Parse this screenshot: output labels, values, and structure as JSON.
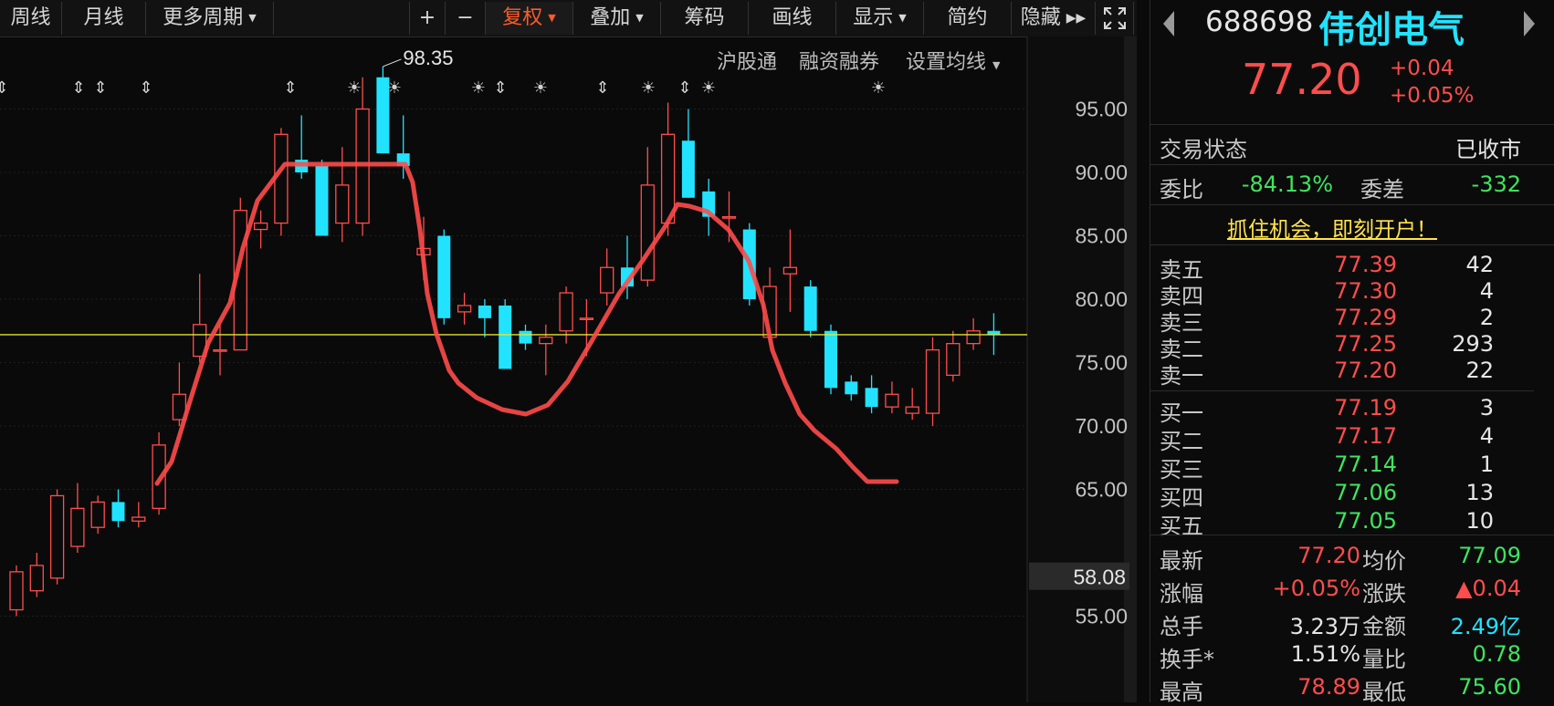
{
  "toolbar": {
    "week": "周线",
    "month": "月线",
    "more_periods": "更多周期",
    "plus": "+",
    "minus": "−",
    "fuquan": "复权",
    "overlay": "叠加",
    "chips": "筹码",
    "draw": "画线",
    "display": "显示",
    "simple": "简约",
    "hide": "隐藏",
    "fullscreen_icon": "expand-icon"
  },
  "subtoolbar": {
    "hgt": "沪股通",
    "margin": "融资融券",
    "ma_settings": "设置均线"
  },
  "chart_data": {
    "type": "candlestick",
    "y_ticks": [
      "95.00",
      "90.00",
      "85.00",
      "80.00",
      "75.00",
      "70.00",
      "65.00",
      "55.00"
    ],
    "ylim": [
      54,
      100
    ],
    "price_line": 77.2,
    "cursor_price": "58.08",
    "high_label": "98.35",
    "annotations_row": [
      "⇕",
      "⇕",
      "⇕",
      "⇕",
      "⇕",
      "☀",
      "☀",
      "☀",
      "⇕",
      "☀",
      "⇕",
      "☀",
      "⇕",
      "☀",
      "☀"
    ],
    "candles": [
      {
        "o": 55.5,
        "c": 58.5,
        "h": 59.0,
        "l": 55.0
      },
      {
        "o": 57.0,
        "c": 59.0,
        "h": 60.0,
        "l": 56.5
      },
      {
        "o": 58.0,
        "c": 64.5,
        "h": 65.0,
        "l": 57.5
      },
      {
        "o": 60.5,
        "c": 63.5,
        "h": 65.5,
        "l": 60.0
      },
      {
        "o": 62.0,
        "c": 64.0,
        "h": 64.5,
        "l": 61.5
      },
      {
        "o": 64.0,
        "c": 62.5,
        "h": 65.0,
        "l": 62.0
      },
      {
        "o": 62.5,
        "c": 62.8,
        "h": 64.0,
        "l": 62.0
      },
      {
        "o": 63.5,
        "c": 68.5,
        "h": 69.5,
        "l": 63.0
      },
      {
        "o": 70.5,
        "c": 72.5,
        "h": 75.0,
        "l": 70.0
      },
      {
        "o": 75.5,
        "c": 78.0,
        "h": 82.0,
        "l": 75.0
      },
      {
        "o": 76.0,
        "c": 76.0,
        "h": 78.0,
        "l": 74.0
      },
      {
        "o": 76.0,
        "c": 87.0,
        "h": 88.0,
        "l": 76.0
      },
      {
        "o": 85.5,
        "c": 86.0,
        "h": 87.0,
        "l": 84.0
      },
      {
        "o": 86.0,
        "c": 93.0,
        "h": 93.5,
        "l": 85.0
      },
      {
        "o": 91.0,
        "c": 90.0,
        "h": 94.5,
        "l": 89.5
      },
      {
        "o": 90.5,
        "c": 85.0,
        "h": 91.0,
        "l": 85.0
      },
      {
        "o": 86.0,
        "c": 89.0,
        "h": 92.0,
        "l": 84.5
      },
      {
        "o": 86.0,
        "c": 95.0,
        "h": 97.5,
        "l": 85.0
      },
      {
        "o": 97.5,
        "c": 91.5,
        "h": 98.35,
        "l": 91.5
      },
      {
        "o": 91.5,
        "c": 90.5,
        "h": 94.5,
        "l": 89.5
      },
      {
        "o": 83.5,
        "c": 84.0,
        "h": 86.5,
        "l": 81.5
      },
      {
        "o": 85.0,
        "c": 78.5,
        "h": 85.5,
        "l": 78.0
      },
      {
        "o": 79.0,
        "c": 79.5,
        "h": 80.5,
        "l": 78.0
      },
      {
        "o": 79.5,
        "c": 78.5,
        "h": 80.0,
        "l": 77.0
      },
      {
        "o": 79.5,
        "c": 74.5,
        "h": 80.0,
        "l": 74.5
      },
      {
        "o": 77.5,
        "c": 76.5,
        "h": 78.0,
        "l": 76.0
      },
      {
        "o": 76.5,
        "c": 77.0,
        "h": 78.0,
        "l": 74.0
      },
      {
        "o": 77.5,
        "c": 80.5,
        "h": 81.0,
        "l": 76.5
      },
      {
        "o": 78.5,
        "c": 78.5,
        "h": 80.0,
        "l": 75.5
      },
      {
        "o": 80.5,
        "c": 82.5,
        "h": 84.0,
        "l": 79.5
      },
      {
        "o": 82.5,
        "c": 81.0,
        "h": 85.0,
        "l": 80.0
      },
      {
        "o": 81.5,
        "c": 89.0,
        "h": 92.0,
        "l": 81.0
      },
      {
        "o": 86.0,
        "c": 93.0,
        "h": 95.5,
        "l": 85.0
      },
      {
        "o": 92.5,
        "c": 88.0,
        "h": 95.0,
        "l": 88.0
      },
      {
        "o": 88.5,
        "c": 86.5,
        "h": 89.5,
        "l": 85.0
      },
      {
        "o": 86.5,
        "c": 86.5,
        "h": 88.5,
        "l": 84.5
      },
      {
        "o": 85.5,
        "c": 80.0,
        "h": 86.0,
        "l": 79.5
      },
      {
        "o": 77.0,
        "c": 81.0,
        "h": 82.5,
        "l": 76.5
      },
      {
        "o": 82.0,
        "c": 82.5,
        "h": 85.5,
        "l": 79.0
      },
      {
        "o": 81.0,
        "c": 77.5,
        "h": 81.5,
        "l": 77.0
      },
      {
        "o": 77.5,
        "c": 73.0,
        "h": 78.0,
        "l": 72.5
      },
      {
        "o": 73.5,
        "c": 72.5,
        "h": 74.0,
        "l": 72.0
      },
      {
        "o": 73.0,
        "c": 71.5,
        "h": 74.0,
        "l": 71.0
      },
      {
        "o": 71.5,
        "c": 72.5,
        "h": 73.5,
        "l": 71.0
      },
      {
        "o": 71.0,
        "c": 71.5,
        "h": 73.0,
        "l": 70.5
      },
      {
        "o": 71.0,
        "c": 76.0,
        "h": 77.0,
        "l": 70.0
      },
      {
        "o": 74.0,
        "c": 76.5,
        "h": 77.5,
        "l": 73.5
      },
      {
        "o": 76.5,
        "c": 77.5,
        "h": 78.5,
        "l": 76.0
      },
      {
        "o": 77.5,
        "c": 77.2,
        "h": 78.89,
        "l": 75.6
      }
    ]
  },
  "quote": {
    "code": "688698",
    "name": "伟创电气",
    "price": "77.20",
    "change": "+0.04",
    "change_pct": "+0.05%",
    "trade_status_label": "交易状态",
    "trade_status": "已收市",
    "weibi_label": "委比",
    "weibi": "-84.13%",
    "weicha_label": "委差",
    "weicha": "-332",
    "promo": "抓住机会，即刻开户！"
  },
  "asks": [
    {
      "label": "卖五",
      "price": "77.39",
      "vol": "42"
    },
    {
      "label": "卖四",
      "price": "77.30",
      "vol": "4"
    },
    {
      "label": "卖三",
      "price": "77.29",
      "vol": "2"
    },
    {
      "label": "卖二",
      "price": "77.25",
      "vol": "293"
    },
    {
      "label": "卖一",
      "price": "77.20",
      "vol": "22"
    }
  ],
  "bids": [
    {
      "label": "买一",
      "price": "77.19",
      "vol": "3"
    },
    {
      "label": "买二",
      "price": "77.17",
      "vol": "4"
    },
    {
      "label": "买三",
      "price": "77.14",
      "vol": "1"
    },
    {
      "label": "买四",
      "price": "77.06",
      "vol": "13"
    },
    {
      "label": "买五",
      "price": "77.05",
      "vol": "10"
    }
  ],
  "stats": [
    {
      "l1": "最新",
      "v1": "77.20",
      "c1": "red",
      "l2": "均价",
      "v2": "77.09",
      "c2": "green"
    },
    {
      "l1": "涨幅",
      "v1": "+0.05%",
      "c1": "red",
      "l2": "涨跌",
      "v2": "▲0.04",
      "c2": "red"
    },
    {
      "l1": "总手",
      "v1": "3.23万",
      "c1": "white",
      "l2": "金额",
      "v2": "2.49亿",
      "c2": "cyan"
    },
    {
      "l1": "换手*",
      "v1": "1.51%",
      "c1": "white",
      "l2": "量比",
      "v2": "0.78",
      "c2": "green"
    },
    {
      "l1": "最高",
      "v1": "78.89",
      "c1": "red",
      "l2": "最低",
      "v2": "75.60",
      "c2": "green"
    }
  ],
  "colors": {
    "up": "#ff4d4d",
    "down": "#22e3ff",
    "price_line": "#e5e52a",
    "pattern": "#ff4a4a"
  }
}
